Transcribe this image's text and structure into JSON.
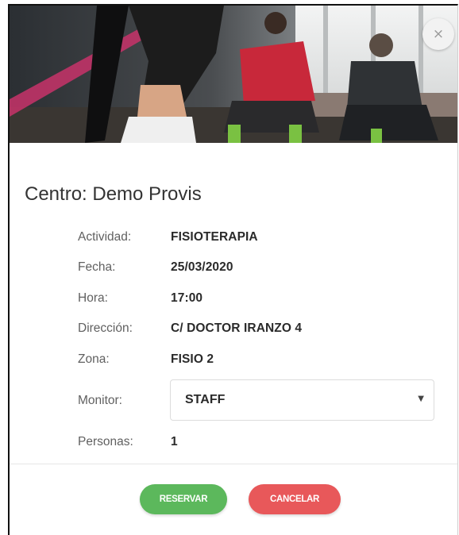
{
  "modal": {
    "close_icon": "close-icon",
    "close_glyph": "×",
    "title": "Centro: Demo Provis"
  },
  "details": {
    "actividad": {
      "label": "Actividad:",
      "value": "FISIOTERAPIA"
    },
    "fecha": {
      "label": "Fecha:",
      "value": "25/03/2020"
    },
    "hora": {
      "label": "Hora:",
      "value": "17:00"
    },
    "direccion": {
      "label": "Dirección:",
      "value": "C/ DOCTOR IRANZO 4"
    },
    "zona": {
      "label": "Zona:",
      "value": "FISIO 2"
    },
    "monitor": {
      "label": "Monitor:",
      "selected": "STAFF"
    },
    "personas": {
      "label": "Personas:",
      "value": "1"
    }
  },
  "actions": {
    "reservar_label": "RESERVAR",
    "cancelar_label": "CANCELAR"
  },
  "colors": {
    "reservar": "#5cb85c",
    "cancelar": "#e8585a"
  }
}
